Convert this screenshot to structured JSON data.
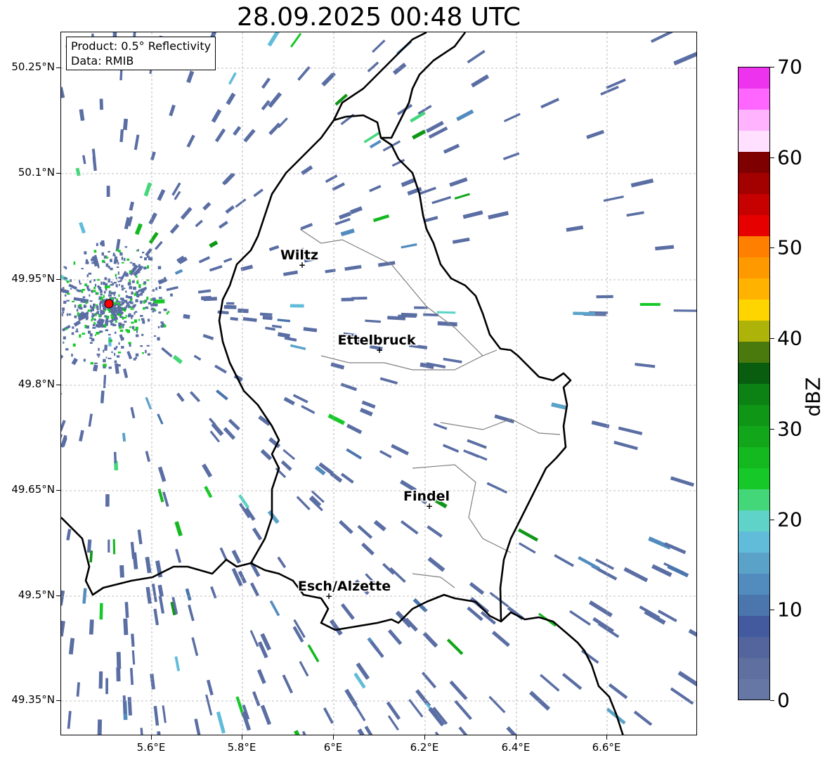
{
  "title": "28.09.2025 00:48 UTC",
  "info_box": {
    "product": "Product: 0.5° Reflectivity",
    "data": "Data: RMIB"
  },
  "latitude_labels": [
    "50.25°N",
    "50.1°N",
    "49.95°N",
    "49.8°N",
    "49.65°N",
    "49.5°N",
    "49.35°N"
  ],
  "longitude_labels": [
    "5.6°E",
    "5.8°E",
    "6°E",
    "6.2°E",
    "6.4°E",
    "6.6°E"
  ],
  "cities": [
    {
      "name": "Wiltz"
    },
    {
      "name": "Ettelbruck"
    },
    {
      "name": "Findel"
    },
    {
      "name": "Esch/Alzette"
    }
  ],
  "radar_site": {
    "color": "#ff0000"
  },
  "colorbar": {
    "unit": "dBZ",
    "min": 0,
    "max": 70,
    "tick_labels": [
      "0",
      "10",
      "20",
      "30",
      "40",
      "50",
      "60",
      "70"
    ],
    "colors": [
      "#6677a6",
      "#5e6fa0",
      "#53659c",
      "#435b9e",
      "#4a75ad",
      "#528cbe",
      "#5ba2c9",
      "#61bcd9",
      "#5fd3c8",
      "#44d77a",
      "#16c928",
      "#14b81f",
      "#12a71a",
      "#0f9617",
      "#0c8214",
      "#085d0e",
      "#4a7a0e",
      "#adb308",
      "#ffd500",
      "#ffb200",
      "#ff9900",
      "#ff7f00",
      "#e60000",
      "#c70000",
      "#a30000",
      "#7f0000",
      "#ffe0ff",
      "#ffb3ff",
      "#ff66ff",
      "#ee33ee"
    ]
  },
  "colors": {
    "border": "#000000",
    "inner_border": "#808080",
    "echo": "#5a6ea4"
  }
}
